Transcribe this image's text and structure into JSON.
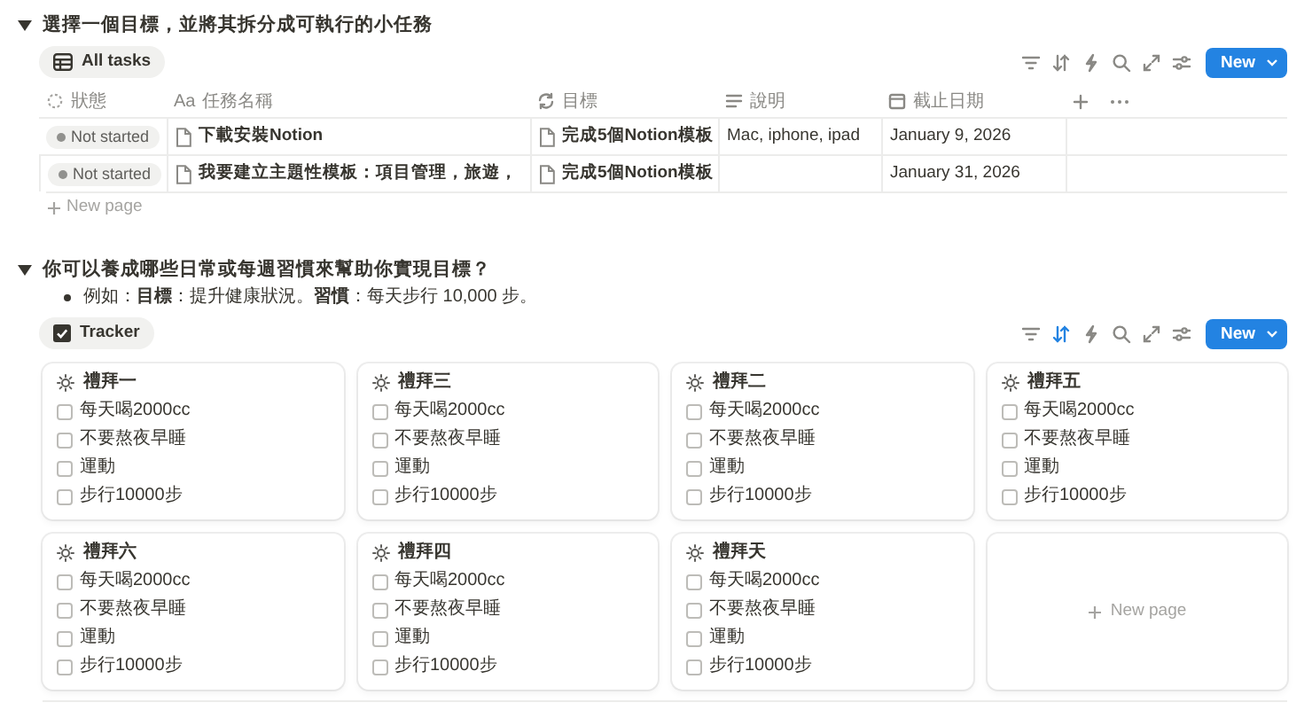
{
  "task_section": {
    "title": "選擇一個目標，並將其拆分成可執行的小任務",
    "expanded": true,
    "view_tab": {
      "label": "All tasks",
      "kind": "table"
    },
    "toolbar": {
      "sort_active": false,
      "new_label": "New"
    },
    "table": {
      "columns": [
        {
          "label": "狀態",
          "kind": "status"
        },
        {
          "label": "任務名稱",
          "kind": "title",
          "icon_text": "Aa"
        },
        {
          "label": "目標",
          "kind": "relation"
        },
        {
          "label": "說明",
          "kind": "text"
        },
        {
          "label": "截止日期",
          "kind": "date"
        }
      ],
      "rows": [
        {
          "status": "Not started",
          "name": "下載安裝Notion",
          "goal": "完成5個Notion模板",
          "description": "Mac, iphone, ipad",
          "due": "January 9, 2026"
        },
        {
          "status": "Not started",
          "name": "我要建立主題性模板：項目管理，旅遊，",
          "goal": "完成5個Notion模板",
          "due": "January 31, 2026"
        }
      ],
      "new_row": "New page"
    }
  },
  "habit_section": {
    "title": "你可以養成哪些日常或每週習慣來幫助你實現目標？",
    "expanded": true,
    "bullets": [
      "例如：**目標**：提升健康狀況。**習慣**：每天步行 10,000 步。"
    ],
    "view_tab": {
      "label": "Tracker",
      "kind": "checkbox"
    },
    "toolbar": {
      "sort_active": true,
      "new_label": "New"
    },
    "cards": [
      {
        "title": "禮拜一",
        "items": [
          {
            "label": "每天喝2000cc",
            "checked": false
          },
          {
            "label": "不要熬夜早睡",
            "checked": false
          },
          {
            "label": "運動",
            "checked": false
          },
          {
            "label": "步行10000步",
            "checked": false
          }
        ]
      },
      {
        "title": "禮拜三",
        "items": [
          {
            "label": "每天喝2000cc",
            "checked": false
          },
          {
            "label": "不要熬夜早睡",
            "checked": false
          },
          {
            "label": "運動",
            "checked": false
          },
          {
            "label": "步行10000步",
            "checked": false
          }
        ]
      },
      {
        "title": "禮拜二",
        "items": [
          {
            "label": "每天喝2000cc",
            "checked": false
          },
          {
            "label": "不要熬夜早睡",
            "checked": false
          },
          {
            "label": "運動",
            "checked": false
          },
          {
            "label": "步行10000步",
            "checked": false
          }
        ]
      },
      {
        "title": "禮拜五",
        "items": [
          {
            "label": "每天喝2000cc",
            "checked": false
          },
          {
            "label": "不要熬夜早睡",
            "checked": false
          },
          {
            "label": "運動",
            "checked": false
          },
          {
            "label": "步行10000步",
            "checked": false
          }
        ]
      },
      {
        "title": "禮拜六",
        "items": [
          {
            "label": "每天喝2000cc",
            "checked": false
          },
          {
            "label": "不要熬夜早睡",
            "checked": false
          },
          {
            "label": "運動",
            "checked": false
          },
          {
            "label": "步行10000步",
            "checked": false
          }
        ]
      },
      {
        "title": "禮拜四",
        "items": [
          {
            "label": "每天喝2000cc",
            "checked": false
          },
          {
            "label": "不要熬夜早睡",
            "checked": false
          },
          {
            "label": "運動",
            "checked": false
          },
          {
            "label": "步行10000步",
            "checked": false
          }
        ]
      },
      {
        "title": "禮拜天",
        "items": [
          {
            "label": "每天喝2000cc",
            "checked": false
          },
          {
            "label": "不要熬夜早睡",
            "checked": false
          },
          {
            "label": "運動",
            "checked": false
          },
          {
            "label": "步行10000步",
            "checked": false
          }
        ]
      }
    ],
    "new_card": "New page"
  }
}
